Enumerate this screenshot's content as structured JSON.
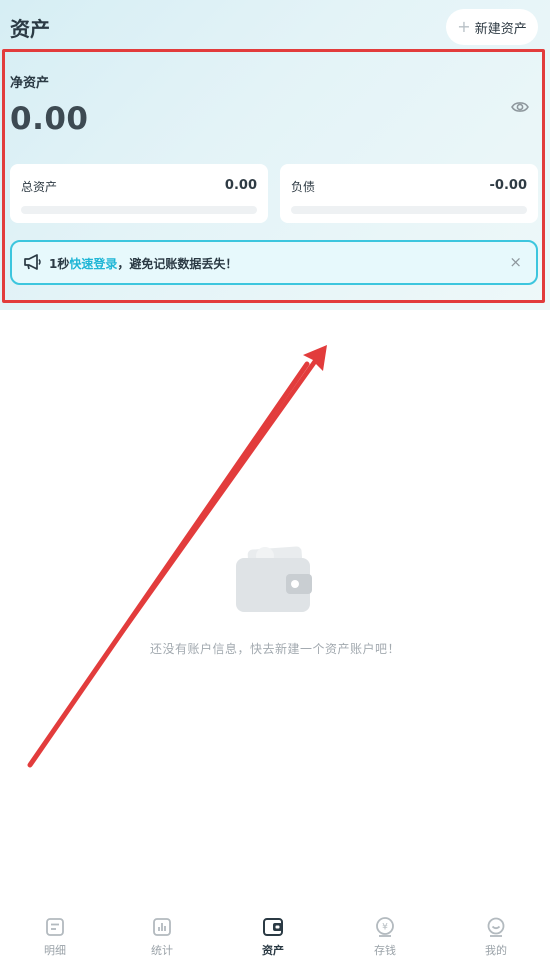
{
  "header": {
    "title": "资产",
    "new_asset_label": "新建资产"
  },
  "summary": {
    "net_label": "净资产",
    "net_value": "0.00",
    "total_assets_label": "总资产",
    "total_assets_value": "0.00",
    "liabilities_label": "负债",
    "liabilities_value": "-0.00"
  },
  "banner": {
    "prefix": "1秒",
    "link": "快速登录",
    "suffix": "，避免记账数据丢失！",
    "close": "×"
  },
  "empty_state": {
    "text": "还没有账户信息，快去新建一个资产账户吧！"
  },
  "tabs": [
    {
      "label": "明细",
      "icon": "list-icon",
      "active": false
    },
    {
      "label": "统计",
      "icon": "chart-icon",
      "active": false
    },
    {
      "label": "资产",
      "icon": "wallet-icon",
      "active": true
    },
    {
      "label": "存钱",
      "icon": "savings-icon",
      "active": false
    },
    {
      "label": "我的",
      "icon": "profile-icon",
      "active": false
    }
  ],
  "colors": {
    "accent": "#1fb6d6",
    "annotation_red": "#e23c3c"
  }
}
